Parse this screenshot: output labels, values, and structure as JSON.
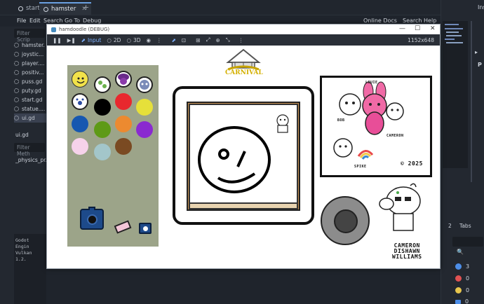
{
  "editor_tabs": [
    {
      "label": "start",
      "active": false
    },
    {
      "label": "hamster",
      "active": true
    }
  ],
  "menu": [
    "File",
    "Edit",
    "Search",
    "Go To",
    "Debug"
  ],
  "top_right_links": [
    "Online Docs",
    "Search Help"
  ],
  "right_dock": {
    "inspector_label": "Ins",
    "tabs_count": "2",
    "tabs_label": "Tabs",
    "badges": [
      {
        "icon": "info-icon",
        "color": "#4d8ee8",
        "count": "3"
      },
      {
        "icon": "error-icon",
        "color": "#e05252",
        "count": "0"
      },
      {
        "icon": "warning-icon",
        "color": "#e8c64d",
        "count": "0"
      },
      {
        "icon": "message-icon",
        "color": "#4d8ee8",
        "count": "0"
      }
    ]
  },
  "scene_panel": {
    "filter_scripts_placeholder": "Filter Scrip",
    "scripts": [
      "hamster.",
      "joystic...",
      "player....",
      "positiv...",
      "puss.gd",
      "puty.gd",
      "start.gd",
      "statue....",
      "ui.gd"
    ],
    "selected_script": "ui.gd",
    "current_file": "ui.gd",
    "filter_methods_placeholder": "Filter Meth",
    "methods": [
      "_physics_pr..."
    ]
  },
  "output": {
    "lines": [
      "Godot Engin",
      "Vulkan 1.2."
    ]
  },
  "game_window": {
    "title": "hamdoodle (DEBUG)",
    "resolution": "1152x648",
    "toolbar": {
      "input": "Input",
      "mode_2d": "2D",
      "mode_3d": "3D"
    }
  },
  "viewport": {
    "logo_text": "CARNIVAL",
    "card_names": [
      "LOUIE",
      "BOB",
      "CAMERON",
      "SPIKE"
    ],
    "copyright": "© 2025",
    "signature": [
      "CAMERON",
      "DISHAWN",
      "WILLIAMS"
    ]
  },
  "palette_colors": [
    "#000000",
    "#e8282e",
    "#e6e03a",
    "#1758b0",
    "#5e9a16",
    "#ec8a30",
    "#8a2ad0",
    "#f6d2ea",
    "#a3c6ca",
    "#7a4a22"
  ]
}
